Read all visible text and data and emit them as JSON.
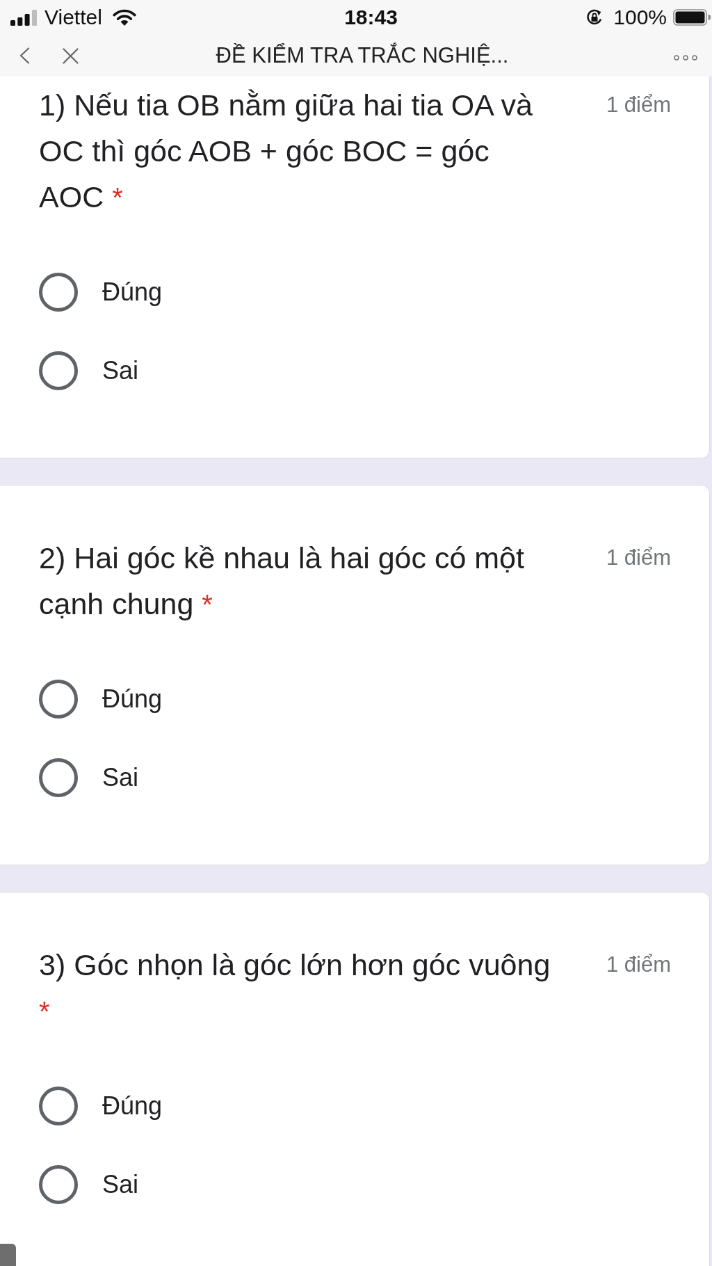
{
  "status_bar": {
    "carrier": "Viettel",
    "time": "18:43",
    "battery": "100%"
  },
  "nav_bar": {
    "title": "ĐỀ KIỂM TRA TRẮC NGHIỆ..."
  },
  "questions": [
    {
      "text": "1) Nếu tia OB nằm giữa hai tia OA và OC thì góc AOB + góc BOC = góc AOC",
      "required_mark": "*",
      "points": "1 điểm",
      "options": [
        {
          "label": "Đúng",
          "selected": false
        },
        {
          "label": "Sai",
          "selected": false
        }
      ]
    },
    {
      "text": "2) Hai góc kề nhau là hai góc có một cạnh chung",
      "required_mark": "*",
      "points": "1 điểm",
      "options": [
        {
          "label": "Đúng",
          "selected": false
        },
        {
          "label": "Sai",
          "selected": false
        }
      ]
    },
    {
      "text": "3) Góc nhọn là góc lớn hơn góc vuông",
      "required_mark": "*",
      "points": "1 điểm",
      "options": [
        {
          "label": "Đúng",
          "selected": false
        },
        {
          "label": "Sai",
          "selected": false
        }
      ]
    }
  ]
}
